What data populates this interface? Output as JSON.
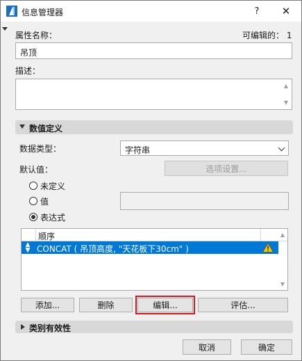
{
  "window": {
    "title": "信息管理器",
    "help_glyph": "?",
    "close_glyph": "✕"
  },
  "property": {
    "name_label": "属性名称：",
    "editable_label": "可编辑的：",
    "editable_value": "1",
    "name_value": "吊顶",
    "desc_label": "描述："
  },
  "value_definition": {
    "header": "数值定义",
    "data_type_label": "数据类型：",
    "data_type_value": "字符串",
    "default_label": "默认值：",
    "options_button": "选项设置...",
    "radio_undefined": "未定义",
    "radio_value": "值",
    "radio_expression": "表达式",
    "selected_radio": "表达式"
  },
  "expression_list": {
    "column_header": "顺序",
    "rows": [
      {
        "text": "CONCAT ( 吊顶高度, \"天花板下30cm\" )",
        "warning": true
      }
    ]
  },
  "actions": {
    "add": "添加...",
    "delete": "删除",
    "edit": "编辑...",
    "evaluate": "评估..."
  },
  "category": {
    "header": "类别有效性"
  },
  "footer": {
    "cancel": "取消",
    "ok": "确定"
  },
  "colors": {
    "selection": "#0078d7",
    "highlight_outline": "#e0141c",
    "warning": "#f2c811"
  },
  "icons": {
    "app": "archicad-logo-icon",
    "warning": "warning-triangle-icon",
    "reorder": "reorder-handle-icon"
  }
}
